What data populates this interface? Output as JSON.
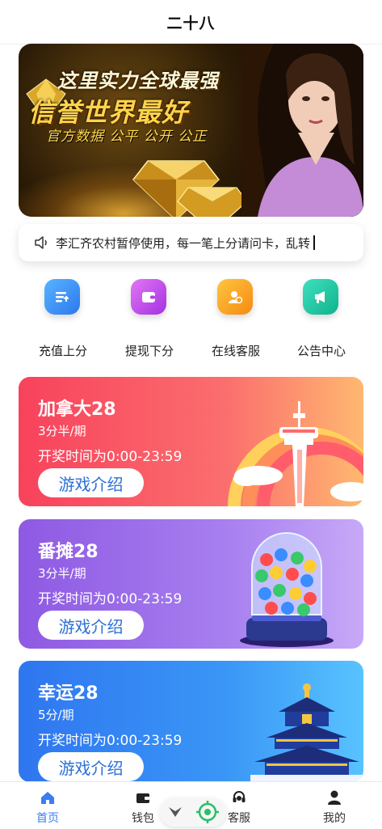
{
  "header": {
    "title": "二十八"
  },
  "banner": {
    "line1": "这里实力全球最强",
    "line2": "信誉世界最好",
    "line3": "官方数据 公平 公开 公正"
  },
  "notice": {
    "text": "李汇齐农村暂停使用，每一笔上分请问卡，乱转"
  },
  "quick_actions": [
    {
      "label": "充值上分",
      "icon": "recharge-icon",
      "color": "#2f86f2"
    },
    {
      "label": "提现下分",
      "icon": "wallet-icon",
      "color": "#c048e8"
    },
    {
      "label": "在线客服",
      "icon": "customer-service-icon",
      "color": "#f7a21b"
    },
    {
      "label": "公告中心",
      "icon": "megaphone-icon",
      "color": "#18c79c"
    }
  ],
  "games": [
    {
      "name": "加拿大28",
      "period": "3分半/期",
      "time": "开奖时间为0:00-23:59",
      "button": "游戏介绍"
    },
    {
      "name": "番摊28",
      "period": "3分半/期",
      "time": "开奖时间为0:00-23:59",
      "button": "游戏介绍"
    },
    {
      "name": "幸运28",
      "period": "5分/期",
      "time": "开奖时间为0:00-23:59",
      "button": "游戏介绍"
    }
  ],
  "tabbar": [
    {
      "label": "首页",
      "icon": "home-icon",
      "active": true
    },
    {
      "label": "钱包",
      "icon": "wallet-icon",
      "active": false
    },
    {
      "label": "客服",
      "icon": "headset-icon",
      "active": false
    },
    {
      "label": "我的",
      "icon": "user-icon",
      "active": false
    }
  ],
  "colors": {
    "accent": "#3b7df2",
    "button_text": "#2c6fd6"
  }
}
